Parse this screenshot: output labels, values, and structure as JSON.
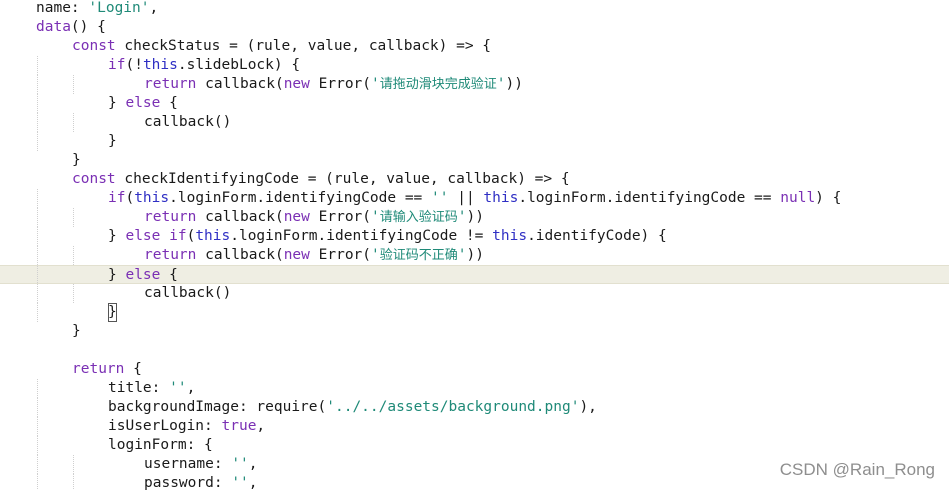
{
  "editor": {
    "lines": [
      {
        "indent": 1,
        "parts": [
          {
            "t": "prop",
            "v": "name"
          },
          {
            "t": "op",
            "v": ": "
          },
          {
            "t": "str",
            "v": "'Login'"
          },
          {
            "t": "op",
            "v": ","
          }
        ]
      },
      {
        "indent": 1,
        "parts": [
          {
            "t": "fn",
            "v": "data"
          },
          {
            "t": "op",
            "v": "() {"
          }
        ]
      },
      {
        "indent": 2,
        "parts": [
          {
            "t": "kw",
            "v": "const"
          },
          {
            "t": "op",
            "v": " checkStatus = (rule, value, callback) => {"
          }
        ]
      },
      {
        "indent": 3,
        "parts": [
          {
            "t": "kw",
            "v": "if"
          },
          {
            "t": "op",
            "v": "(!"
          },
          {
            "t": "this",
            "v": "this"
          },
          {
            "t": "op",
            "v": ".slidebLock) {"
          }
        ]
      },
      {
        "indent": 4,
        "parts": [
          {
            "t": "kw",
            "v": "return"
          },
          {
            "t": "op",
            "v": " callback("
          },
          {
            "t": "kw",
            "v": "new"
          },
          {
            "t": "op",
            "v": " Error("
          },
          {
            "t": "str",
            "v": "'"
          },
          {
            "t": "cjk",
            "v": "请拖动滑块完成验证"
          },
          {
            "t": "str",
            "v": "'"
          },
          {
            "t": "op",
            "v": "))"
          }
        ]
      },
      {
        "indent": 3,
        "parts": [
          {
            "t": "op",
            "v": "} "
          },
          {
            "t": "kw",
            "v": "else"
          },
          {
            "t": "op",
            "v": " {"
          }
        ]
      },
      {
        "indent": 4,
        "parts": [
          {
            "t": "op",
            "v": "callback()"
          }
        ]
      },
      {
        "indent": 3,
        "parts": [
          {
            "t": "op",
            "v": "}"
          }
        ]
      },
      {
        "indent": 2,
        "parts": [
          {
            "t": "op",
            "v": "}"
          }
        ]
      },
      {
        "indent": 2,
        "parts": [
          {
            "t": "kw",
            "v": "const"
          },
          {
            "t": "op",
            "v": " checkIdentifyingCode = (rule, value, callback) => {"
          }
        ]
      },
      {
        "indent": 3,
        "parts": [
          {
            "t": "kw",
            "v": "if"
          },
          {
            "t": "op",
            "v": "("
          },
          {
            "t": "this",
            "v": "this"
          },
          {
            "t": "op",
            "v": ".loginForm.identifyingCode == "
          },
          {
            "t": "str",
            "v": "''"
          },
          {
            "t": "op",
            "v": " || "
          },
          {
            "t": "this",
            "v": "this"
          },
          {
            "t": "op",
            "v": ".loginForm.identifyingCode == "
          },
          {
            "t": "null",
            "v": "null"
          },
          {
            "t": "op",
            "v": ") {"
          }
        ]
      },
      {
        "indent": 4,
        "parts": [
          {
            "t": "kw",
            "v": "return"
          },
          {
            "t": "op",
            "v": " callback("
          },
          {
            "t": "kw",
            "v": "new"
          },
          {
            "t": "op",
            "v": " Error("
          },
          {
            "t": "str",
            "v": "'"
          },
          {
            "t": "cjk",
            "v": "请输入验证码"
          },
          {
            "t": "str",
            "v": "'"
          },
          {
            "t": "op",
            "v": "))"
          }
        ]
      },
      {
        "indent": 3,
        "parts": [
          {
            "t": "op",
            "v": "} "
          },
          {
            "t": "kw",
            "v": "else if"
          },
          {
            "t": "op",
            "v": "("
          },
          {
            "t": "this",
            "v": "this"
          },
          {
            "t": "op",
            "v": ".loginForm.identifyingCode != "
          },
          {
            "t": "this",
            "v": "this"
          },
          {
            "t": "op",
            "v": ".identifyCode) {"
          }
        ]
      },
      {
        "indent": 4,
        "parts": [
          {
            "t": "kw",
            "v": "return"
          },
          {
            "t": "op",
            "v": " callback("
          },
          {
            "t": "kw",
            "v": "new"
          },
          {
            "t": "op",
            "v": " Error("
          },
          {
            "t": "str",
            "v": "'"
          },
          {
            "t": "cjk",
            "v": "验证码不正确"
          },
          {
            "t": "str",
            "v": "'"
          },
          {
            "t": "op",
            "v": "))"
          }
        ]
      },
      {
        "indent": 3,
        "current": true,
        "parts": [
          {
            "t": "op",
            "v": "} "
          },
          {
            "t": "kw",
            "v": "else"
          },
          {
            "t": "op",
            "v": " {"
          }
        ]
      },
      {
        "indent": 4,
        "parts": [
          {
            "t": "op",
            "v": "callback()"
          }
        ]
      },
      {
        "indent": 3,
        "parts": [
          {
            "t": "caret",
            "v": "}"
          }
        ]
      },
      {
        "indent": 2,
        "parts": [
          {
            "t": "op",
            "v": "}"
          }
        ]
      },
      {
        "indent": 0,
        "parts": []
      },
      {
        "indent": 2,
        "parts": [
          {
            "t": "kw",
            "v": "return"
          },
          {
            "t": "op",
            "v": " {"
          }
        ]
      },
      {
        "indent": 3,
        "parts": [
          {
            "t": "prop",
            "v": "title"
          },
          {
            "t": "op",
            "v": ": "
          },
          {
            "t": "str",
            "v": "''"
          },
          {
            "t": "op",
            "v": ","
          }
        ]
      },
      {
        "indent": 3,
        "parts": [
          {
            "t": "prop",
            "v": "backgroundImage"
          },
          {
            "t": "op",
            "v": ": require("
          },
          {
            "t": "str",
            "v": "'../../assets/background.png'"
          },
          {
            "t": "op",
            "v": "),"
          }
        ]
      },
      {
        "indent": 3,
        "parts": [
          {
            "t": "prop",
            "v": "isUserLogin"
          },
          {
            "t": "op",
            "v": ": "
          },
          {
            "t": "null",
            "v": "true"
          },
          {
            "t": "op",
            "v": ","
          }
        ]
      },
      {
        "indent": 3,
        "parts": [
          {
            "t": "prop",
            "v": "loginForm"
          },
          {
            "t": "op",
            "v": ": {"
          }
        ]
      },
      {
        "indent": 4,
        "parts": [
          {
            "t": "prop",
            "v": "username"
          },
          {
            "t": "op",
            "v": ": "
          },
          {
            "t": "str",
            "v": "''"
          },
          {
            "t": "op",
            "v": ","
          }
        ]
      },
      {
        "indent": 4,
        "parts": [
          {
            "t": "prop",
            "v": "password"
          },
          {
            "t": "op",
            "v": ": "
          },
          {
            "t": "str",
            "v": "''"
          },
          {
            "t": "op",
            "v": ","
          }
        ]
      }
    ]
  },
  "watermark": "CSDN @Rain_Rong",
  "colors": {
    "keyword": "#7a2fb4",
    "this": "#2f2fc4",
    "string": "#1f8a78",
    "text": "#1a1a1a",
    "current_line": "#efeee3"
  }
}
